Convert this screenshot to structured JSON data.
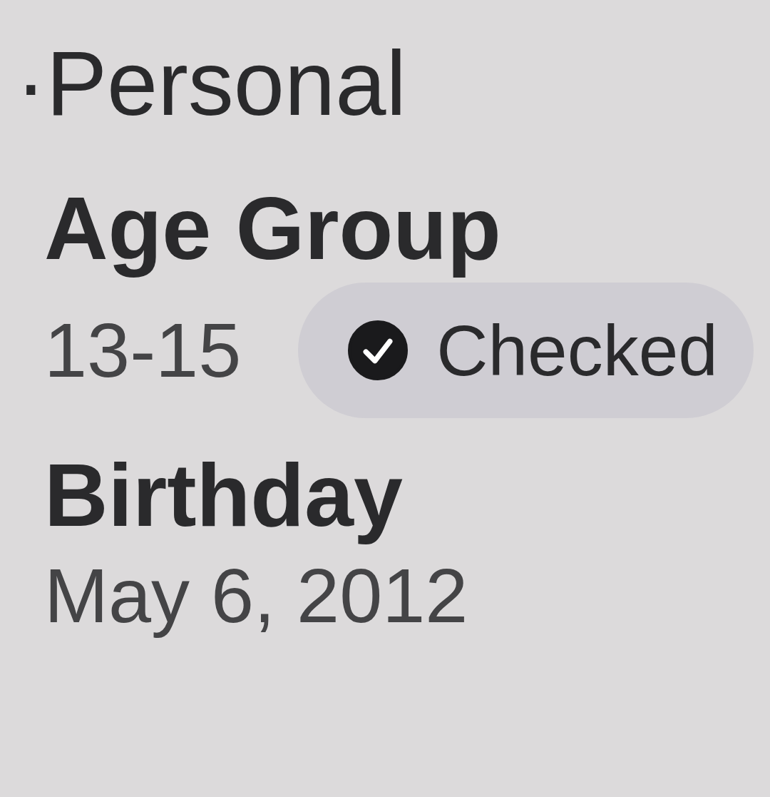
{
  "section": {
    "title": "·Personal"
  },
  "fields": [
    {
      "label": "Age Group",
      "value": "13-15",
      "badge": {
        "text": "Checked",
        "checked": true
      }
    },
    {
      "label": "Birthday",
      "value": "May 6, 2012"
    }
  ]
}
